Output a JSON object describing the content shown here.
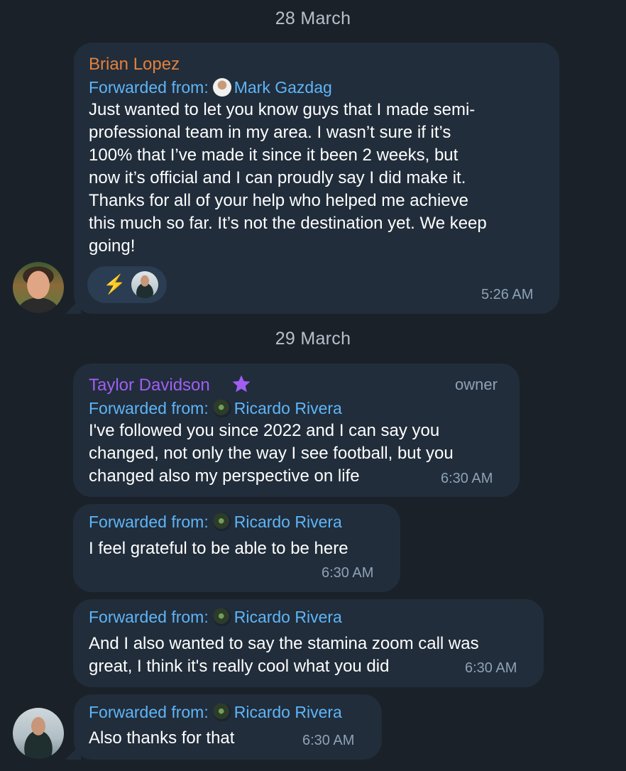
{
  "dates": [
    "28 March",
    "29 March"
  ],
  "colors": {
    "background": "#1a2129",
    "bubble": "#212d3b",
    "link": "#5eb5f7",
    "brian": "#e3813c",
    "taylor": "#a15ef2"
  },
  "messages": [
    {
      "sender": "Brian Lopez",
      "forwarded_label": "Forwarded from:",
      "forwarded_name": "Mark Gazdag",
      "lines": [
        "Just wanted to let you know guys that I made semi-",
        "professional team in my area. I wasn’t sure if it’s",
        "100% that I’ve made it since it been 2 weeks, but",
        "now it’s official and I can proudly say I did make it.",
        "Thanks for all of your help who helped me achieve",
        "this much so far. It’s not the destination yet. We keep",
        "going!"
      ],
      "reaction": "⚡",
      "time": "5:26 AM"
    },
    {
      "sender": "Taylor Davidson",
      "role": "owner",
      "forwarded_label": "Forwarded from:",
      "forwarded_name": "Ricardo Rivera",
      "lines": [
        "I've followed you since 2022 and I can say you",
        "changed, not only the way I see football, but you",
        "changed also my perspective on life"
      ],
      "time": "6:30 AM"
    },
    {
      "forwarded_label": "Forwarded from:",
      "forwarded_name": "Ricardo Rivera",
      "lines": [
        "I feel grateful to be able to be here"
      ],
      "time": "6:30 AM"
    },
    {
      "forwarded_label": "Forwarded from:",
      "forwarded_name": "Ricardo Rivera",
      "lines": [
        "And I also wanted to say the stamina zoom call was",
        "great, I think it's really cool what you did"
      ],
      "time": "6:30 AM"
    },
    {
      "forwarded_label": "Forwarded from:",
      "forwarded_name": "Ricardo Rivera",
      "lines": [
        "Also thanks for that"
      ],
      "time": "6:30 AM"
    }
  ]
}
